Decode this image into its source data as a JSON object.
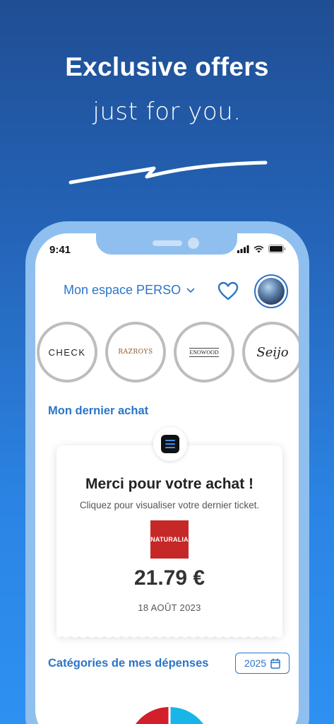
{
  "hero": {
    "headline": "Exclusive offers",
    "subline": "just for you."
  },
  "status_bar": {
    "time": "9:41"
  },
  "header": {
    "space_title": "Mon espace PERSO"
  },
  "brands": [
    {
      "name": "CHECK"
    },
    {
      "name": "RAZROYS"
    },
    {
      "name": "ENOWOOD"
    },
    {
      "name": "Seijo"
    }
  ],
  "last_purchase": {
    "section_title": "Mon dernier achat",
    "card_title": "Merci pour votre achat !",
    "card_subtitle": "Cliquez pour visualiser votre dernier ticket.",
    "store_name": "NATURALIA",
    "amount": "21.79 €",
    "date": "18 AOÛT 2023"
  },
  "spending": {
    "section_title": "Catégories de mes dépenses",
    "year": "2025"
  },
  "colors": {
    "accent": "#2a75c9",
    "store_red": "#c62828"
  }
}
